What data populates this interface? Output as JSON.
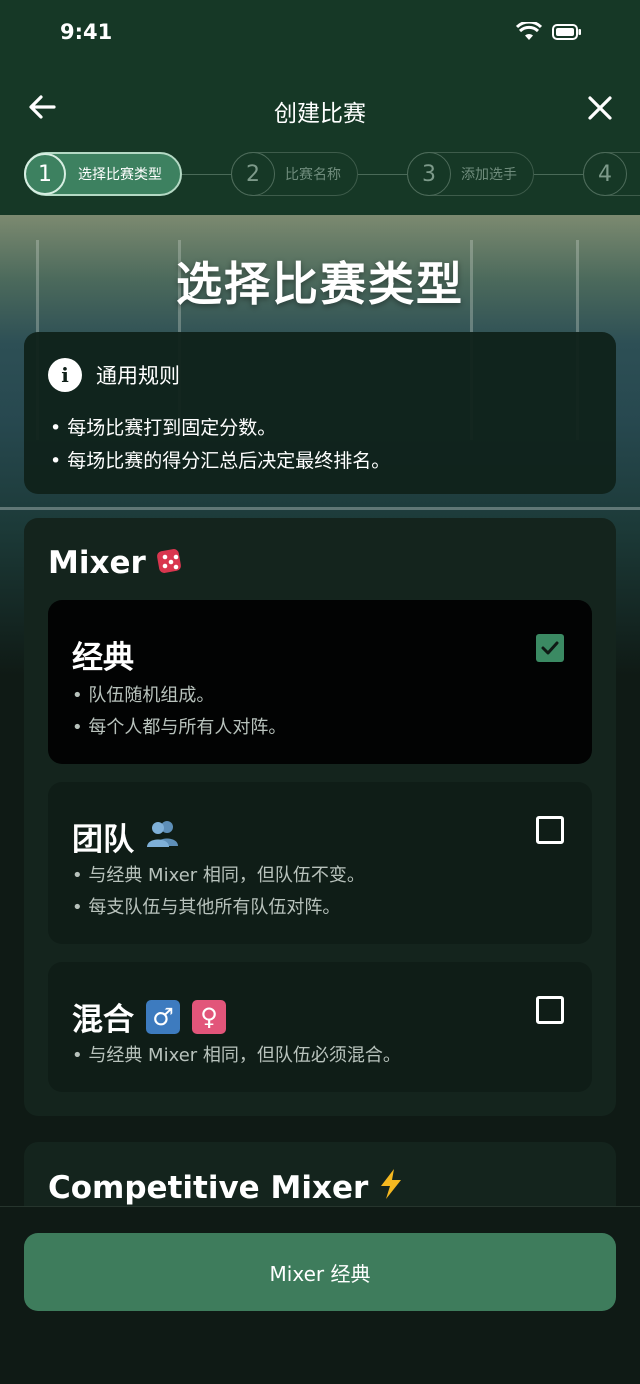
{
  "status_bar": {
    "time": "9:41"
  },
  "nav": {
    "title": "创建比赛"
  },
  "stepper": {
    "steps": [
      {
        "num": "1",
        "label": "选择比赛类型"
      },
      {
        "num": "2",
        "label": "比赛名称"
      },
      {
        "num": "3",
        "label": "添加选手"
      },
      {
        "num": "4",
        "label": ""
      }
    ]
  },
  "hero": {
    "title": "选择比赛类型"
  },
  "rules": {
    "title": "通用规则",
    "items": [
      "• 每场比赛打到固定分数。",
      "• 每场比赛的得分汇总后决定最终排名。"
    ]
  },
  "mixer": {
    "title": "Mixer",
    "options": [
      {
        "title": "经典",
        "bullets": [
          "• 队伍随机组成。",
          "• 每个人都与所有人对阵。"
        ],
        "checked": true
      },
      {
        "title": "团队",
        "bullets": [
          "• 与经典 Mixer 相同，但队伍不变。",
          "• 每支队伍与其他所有队伍对阵。"
        ],
        "checked": false
      },
      {
        "title": "混合",
        "bullets": [
          "• 与经典 Mixer 相同，但队伍必须混合。"
        ],
        "checked": false
      }
    ]
  },
  "competitive": {
    "title": "Competitive Mixer"
  },
  "footer": {
    "button_label": "Mixer 经典"
  },
  "colors": {
    "accent": "#3e7c5c",
    "background": "#0f1a15",
    "header": "#163826"
  },
  "icons": [
    "back-arrow-icon",
    "close-icon",
    "wifi-icon",
    "battery-icon",
    "info-icon",
    "dice-icon",
    "team-icon",
    "male-icon",
    "female-icon",
    "lightning-icon",
    "checkmark-icon"
  ]
}
